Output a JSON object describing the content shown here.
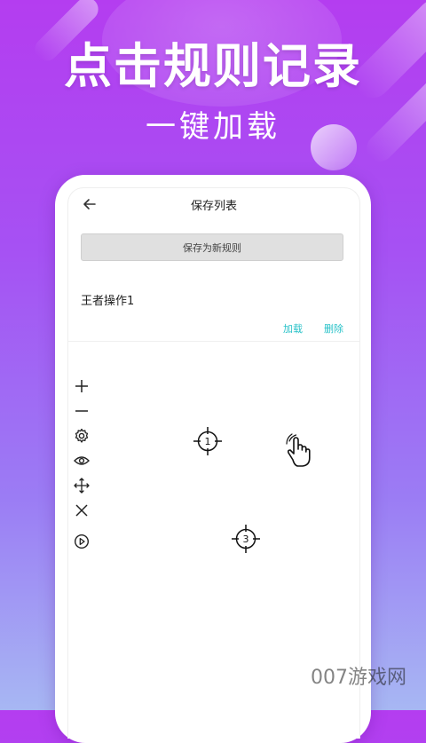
{
  "promo": {
    "headline": "点击规则记录",
    "subheadline": "一键加载"
  },
  "app": {
    "title": "保存列表",
    "save_new_button": "保存为新规则",
    "rules": [
      {
        "name": "王者操作1",
        "load_label": "加载",
        "delete_label": "删除"
      }
    ]
  },
  "toolbar": {
    "tools": [
      "plus-icon",
      "minus-icon",
      "gear-icon",
      "eye-icon",
      "move-icon",
      "close-icon",
      "play-icon"
    ]
  },
  "targets": [
    {
      "label": "1"
    },
    {
      "label": "3"
    }
  ],
  "watermark": "007游戏网",
  "colors": {
    "accent": "#28c2c8",
    "background_top": "#b43df0",
    "background_bottom": "#a7b7f3"
  }
}
